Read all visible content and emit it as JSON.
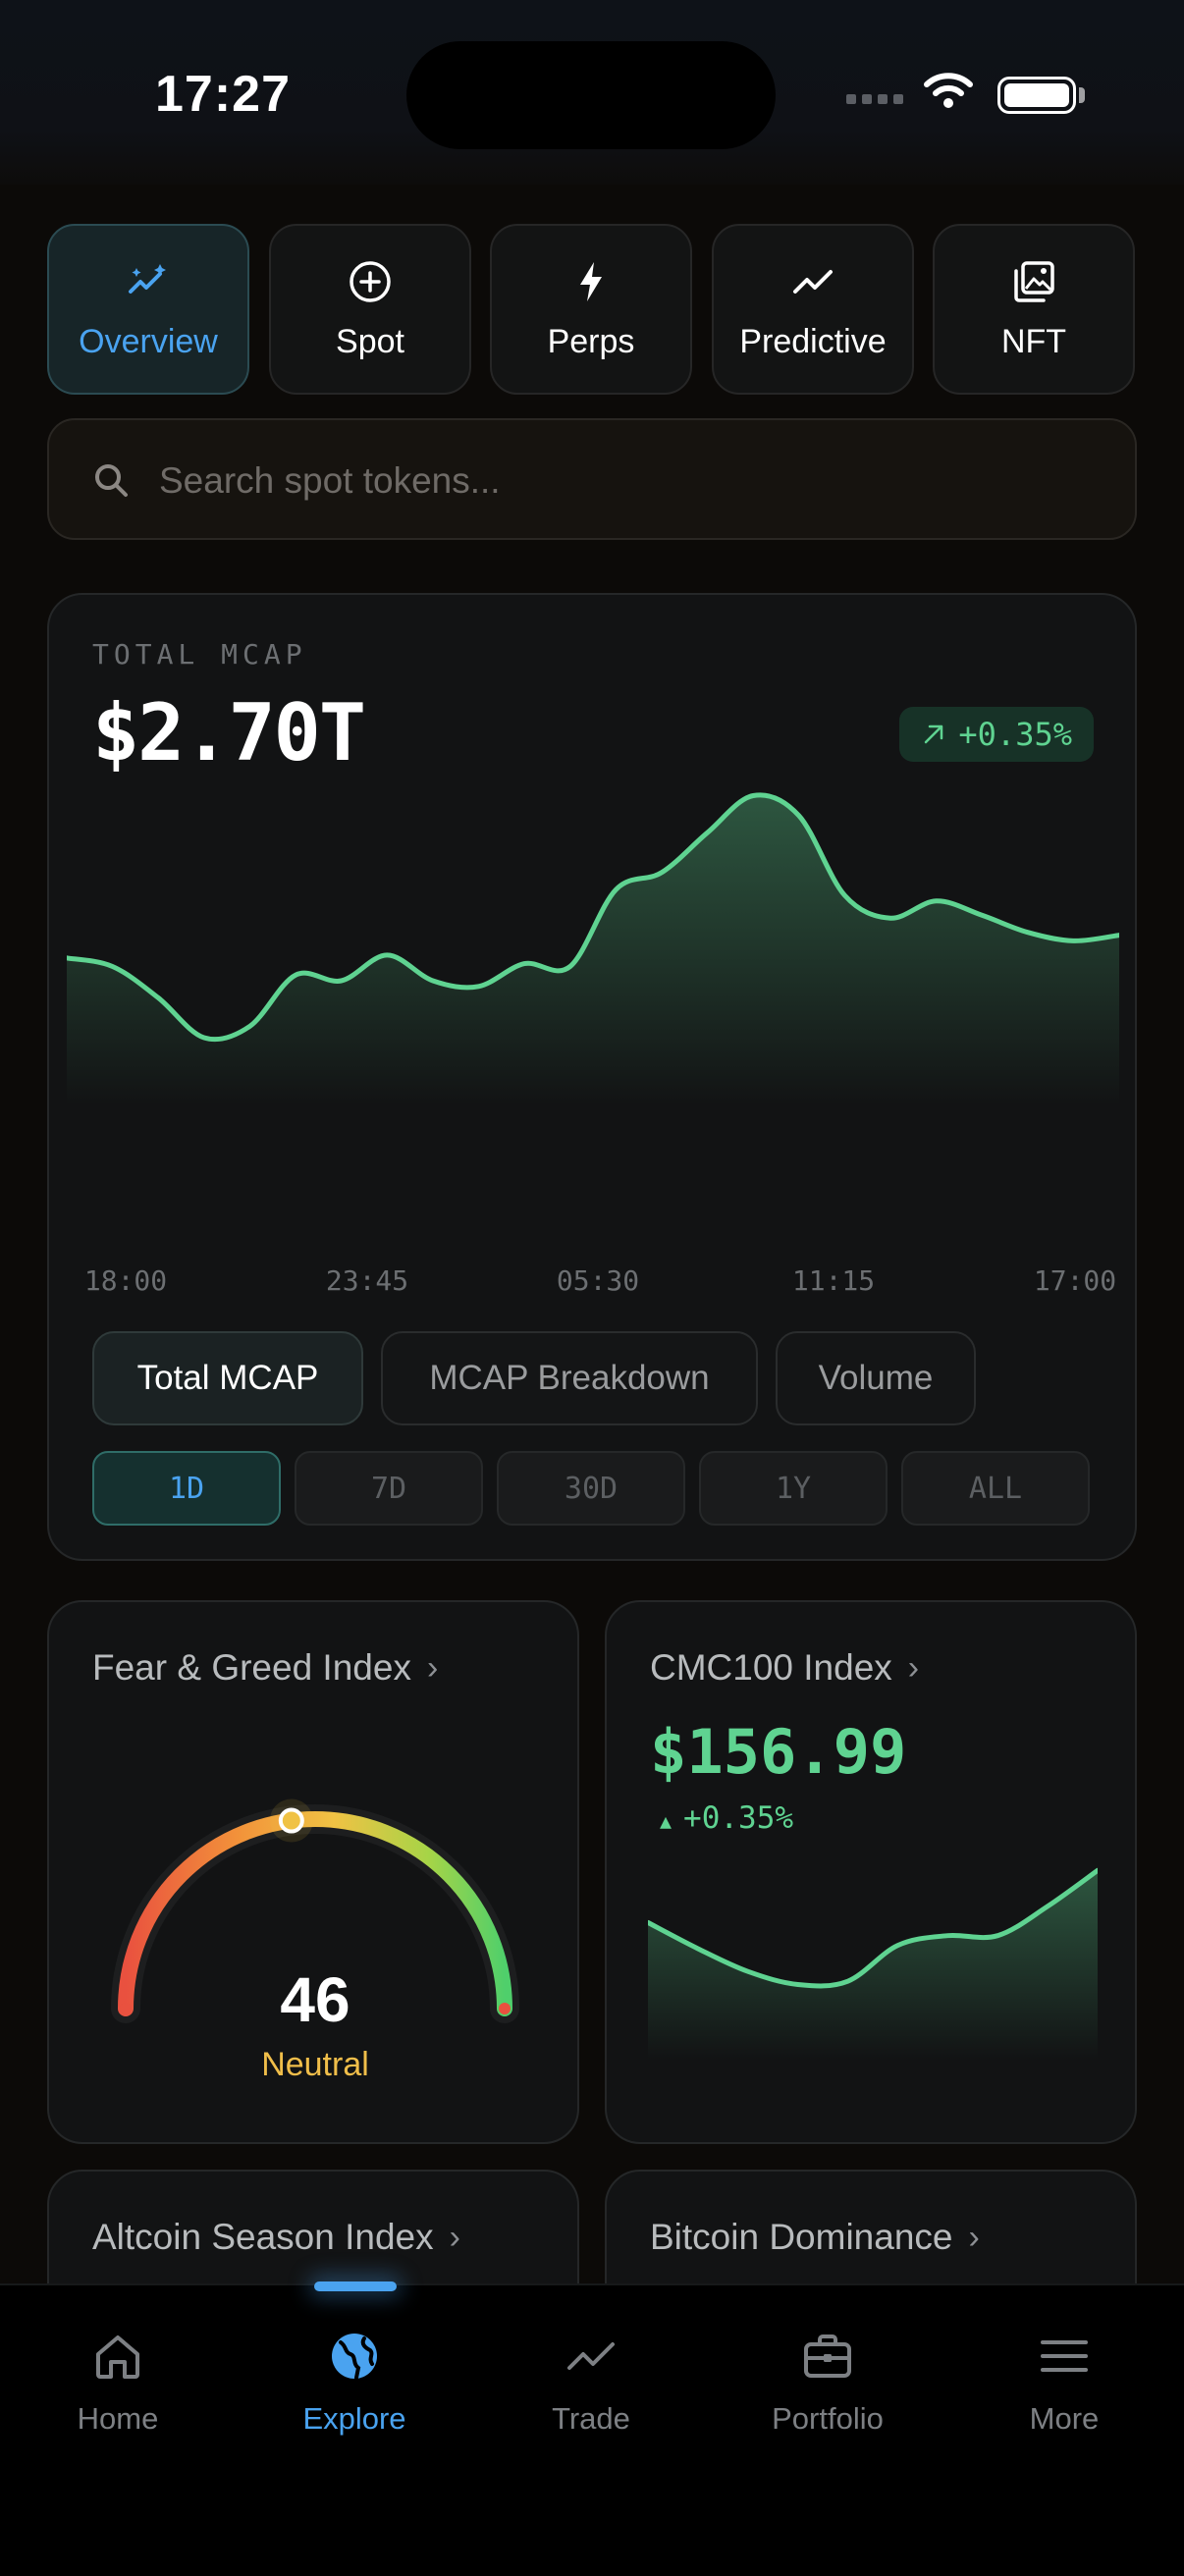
{
  "status_bar": {
    "time": "17:27"
  },
  "categories": [
    {
      "label": "Overview",
      "icon": "sparkle-chart-icon",
      "active": true
    },
    {
      "label": "Spot",
      "icon": "plus-circle-icon",
      "active": false
    },
    {
      "label": "Perps",
      "icon": "lightning-icon",
      "active": false
    },
    {
      "label": "Predictive",
      "icon": "trend-line-icon",
      "active": false
    },
    {
      "label": "NFT",
      "icon": "gallery-icon",
      "active": false
    }
  ],
  "search": {
    "placeholder": "Search spot tokens..."
  },
  "mcap": {
    "label": "TOTAL MCAP",
    "value": "$2.70T",
    "change": "+0.35%",
    "views": [
      "Total MCAP",
      "MCAP Breakdown",
      "Volume"
    ],
    "active_view": "Total MCAP",
    "ranges": [
      "1D",
      "7D",
      "30D",
      "1Y",
      "ALL"
    ],
    "active_range": "1D"
  },
  "chart_data": [
    {
      "type": "area",
      "title": "TOTAL MCAP",
      "x_tick_labels": [
        "18:00",
        "23:45",
        "05:30",
        "11:15",
        "17:00"
      ],
      "values": [
        38,
        35,
        24,
        10,
        14,
        32,
        30,
        39,
        30,
        28,
        36,
        35,
        62,
        68,
        82,
        95,
        88,
        60,
        52,
        58,
        53,
        47,
        44,
        46
      ],
      "color": "#5fd391",
      "grid": false
    },
    {
      "type": "area",
      "title": "CMC100 Index",
      "values": [
        60,
        44,
        30,
        22,
        24,
        46,
        52,
        52,
        70,
        92
      ],
      "color": "#5fd391",
      "grid": false
    }
  ],
  "fear_greed": {
    "title": "Fear & Greed Index",
    "value": "46",
    "label": "Neutral",
    "score": 46
  },
  "cmc100": {
    "title": "CMC100 Index",
    "value": "$156.99",
    "change": "+0.35%"
  },
  "altcoin": {
    "title": "Altcoin Season Index"
  },
  "btc_dominance": {
    "title": "Bitcoin Dominance"
  },
  "nav": [
    {
      "label": "Home",
      "icon": "home-icon",
      "active": false
    },
    {
      "label": "Explore",
      "icon": "globe-icon",
      "active": true
    },
    {
      "label": "Trade",
      "icon": "trend-line-icon",
      "active": false
    },
    {
      "label": "Portfolio",
      "icon": "briefcase-icon",
      "active": false
    },
    {
      "label": "More",
      "icon": "menu-icon",
      "active": false
    }
  ],
  "colors": {
    "accent": "#4aa3f0",
    "positive": "#5fd391",
    "neutral": "#f0be4a"
  }
}
